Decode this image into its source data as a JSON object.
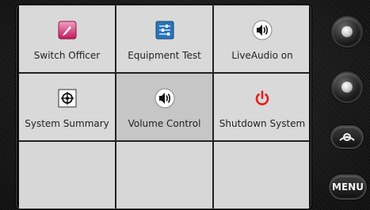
{
  "tiles": [
    {
      "label": "Switch Officer",
      "icon": "pen-icon"
    },
    {
      "label": "Equipment Test",
      "icon": "sliders-icon"
    },
    {
      "label": "LiveAudio on",
      "icon": "speaker-icon"
    },
    {
      "label": "System Summary",
      "icon": "target-icon"
    },
    {
      "label": "Volume Control",
      "icon": "speaker-icon"
    },
    {
      "label": "Shutdown System",
      "icon": "power-icon"
    }
  ],
  "hardware": {
    "menu_label": "MENU"
  },
  "colors": {
    "tile_bg": "#d9d9d9",
    "power_red": "#e0201a",
    "pen_pink": "#d4306e",
    "sliders_blue": "#2a74b8"
  }
}
